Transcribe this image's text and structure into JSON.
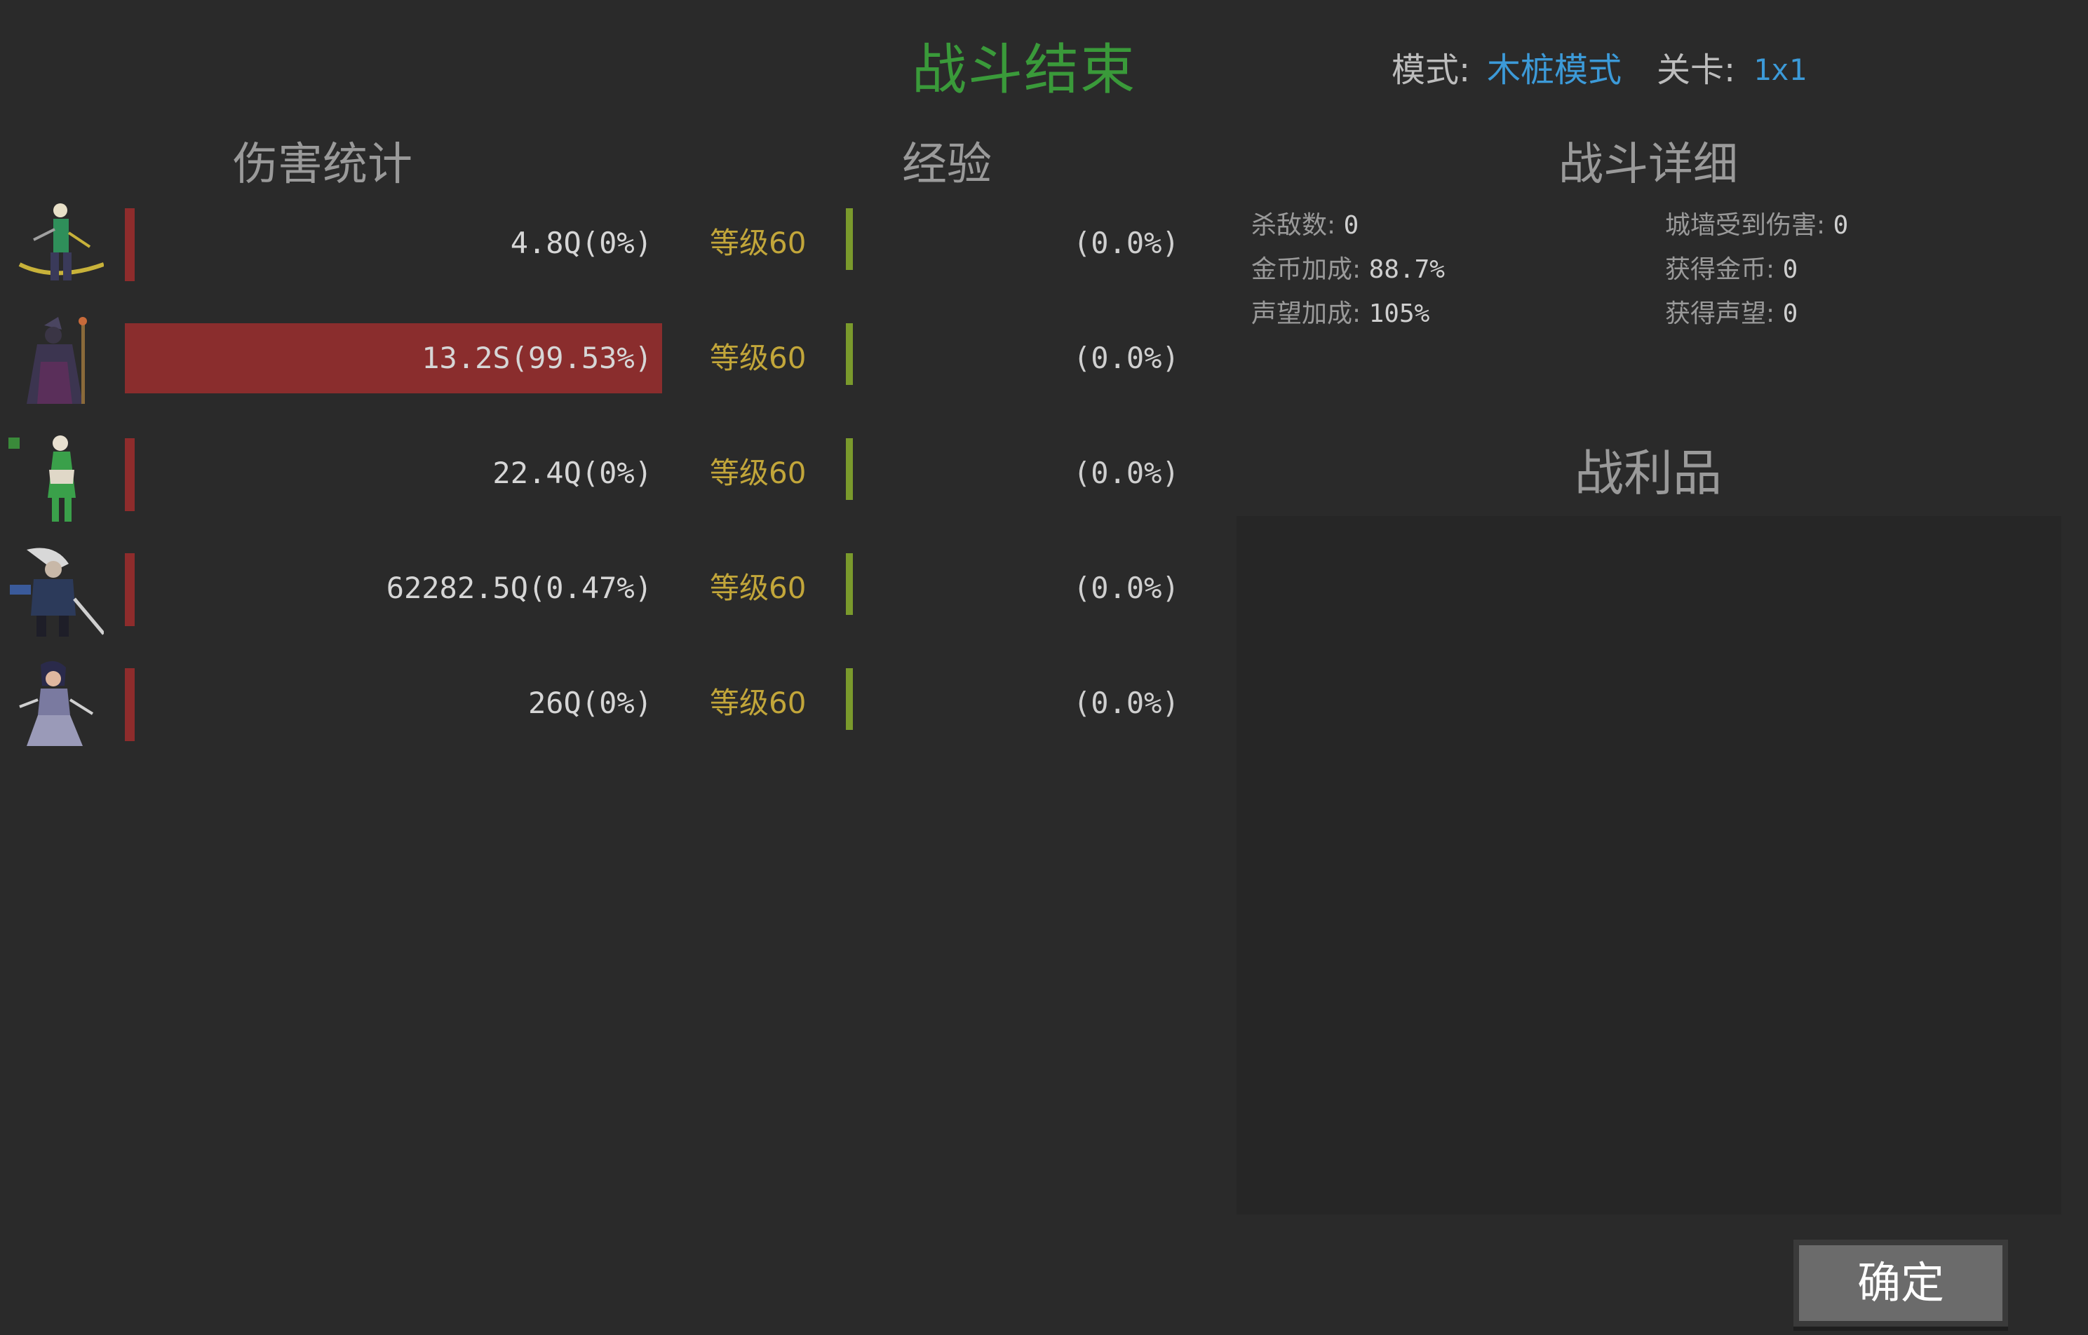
{
  "header": {
    "title": "战斗结束",
    "mode_label": "模式:",
    "mode_value": "木桩模式",
    "stage_label": "关卡:",
    "stage_value": "1x1"
  },
  "sections": {
    "damage": "伤害统计",
    "exp": "经验",
    "details": "战斗详细",
    "loot": "战利品"
  },
  "heroes": [
    {
      "portrait": "elf-archer-icon",
      "damage": "4.8Q(0%)",
      "damage_share": 0.0,
      "level": "等级60",
      "exp": "(0.0%)"
    },
    {
      "portrait": "dark-mage-icon",
      "damage": "13.2S(99.53%)",
      "damage_share": 0.9953,
      "level": "等级60",
      "exp": "(0.0%)"
    },
    {
      "portrait": "druid-icon",
      "damage": "22.4Q(0%)",
      "damage_share": 0.0,
      "level": "等级60",
      "exp": "(0.0%)"
    },
    {
      "portrait": "swordsman-icon",
      "damage": "62282.5Q(0.47%)",
      "damage_share": 0.0047,
      "level": "等级60",
      "exp": "(0.0%)"
    },
    {
      "portrait": "warrior-woman-icon",
      "damage": "26Q(0%)",
      "damage_share": 0.0,
      "level": "等级60",
      "exp": "(0.0%)"
    }
  ],
  "details": {
    "kills_label": "杀敌数:",
    "kills_value": "0",
    "wall_damage_label": "城墙受到伤害:",
    "wall_damage_value": "0",
    "gold_bonus_label": "金币加成:",
    "gold_bonus_value": "88.7%",
    "gold_gained_label": "获得金币:",
    "gold_gained_value": "0",
    "fame_bonus_label": "声望加成:",
    "fame_bonus_value": "105%",
    "fame_gained_label": "获得声望:",
    "fame_gained_value": "0"
  },
  "buttons": {
    "confirm": "确定"
  },
  "colors": {
    "background": "#2a2a2a",
    "title": "#3a9a3a",
    "accent_blue": "#3c9ad8",
    "damage_bar": "#8a2d2d",
    "level_text": "#c2a63a",
    "exp_marker": "#7a9a2c"
  }
}
